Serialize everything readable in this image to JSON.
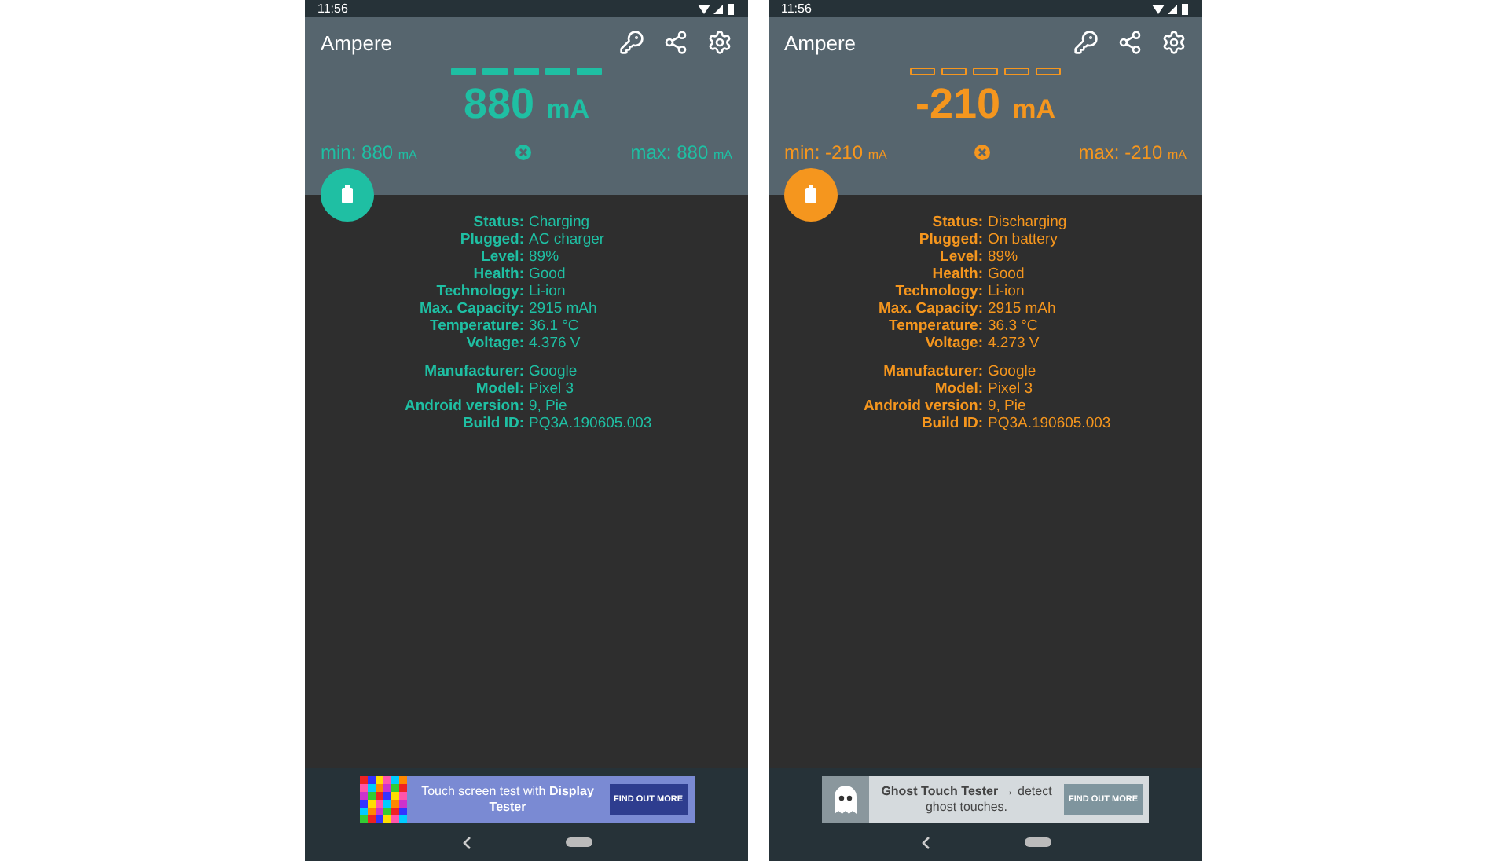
{
  "phones": [
    {
      "status_bar": {
        "time": "11:56"
      },
      "app_bar": {
        "title": "Ampere"
      },
      "color": "#1fbfa3",
      "meter": {
        "filled": true
      },
      "reading": {
        "value": "880",
        "unit": "mA"
      },
      "min": {
        "label": "min:",
        "value": "880",
        "unit": "mA"
      },
      "max": {
        "label": "max:",
        "value": "880",
        "unit": "mA"
      },
      "info_groups": [
        [
          {
            "label": "Status:",
            "value": "Charging"
          },
          {
            "label": "Plugged:",
            "value": "AC charger"
          },
          {
            "label": "Level:",
            "value": "89%"
          },
          {
            "label": "Health:",
            "value": "Good"
          },
          {
            "label": "Technology:",
            "value": "Li-ion"
          },
          {
            "label": "Max. Capacity:",
            "value": "2915 mAh"
          },
          {
            "label": "Temperature:",
            "value": "36.1 °C"
          },
          {
            "label": "Voltage:",
            "value": "4.376 V"
          }
        ],
        [
          {
            "label": "Manufacturer:",
            "value": "Google"
          },
          {
            "label": "Model:",
            "value": "Pixel 3"
          },
          {
            "label": "Android version:",
            "value": "9, Pie"
          },
          {
            "label": "Build ID:",
            "value": "PQ3A.190605.003"
          }
        ]
      ],
      "ad": {
        "kind": "pixels",
        "text": "Touch screen test with **Display Tester**",
        "button": "FIND OUT MORE"
      }
    },
    {
      "status_bar": {
        "time": "11:56"
      },
      "app_bar": {
        "title": "Ampere"
      },
      "color": "#f5961e",
      "meter": {
        "filled": false
      },
      "reading": {
        "value": "-210",
        "unit": "mA"
      },
      "min": {
        "label": "min:",
        "value": "-210",
        "unit": "mA"
      },
      "max": {
        "label": "max:",
        "value": "-210",
        "unit": "mA"
      },
      "info_groups": [
        [
          {
            "label": "Status:",
            "value": "Discharging"
          },
          {
            "label": "Plugged:",
            "value": "On battery"
          },
          {
            "label": "Level:",
            "value": "89%"
          },
          {
            "label": "Health:",
            "value": "Good"
          },
          {
            "label": "Technology:",
            "value": "Li-ion"
          },
          {
            "label": "Max. Capacity:",
            "value": "2915 mAh"
          },
          {
            "label": "Temperature:",
            "value": "36.3 °C"
          },
          {
            "label": "Voltage:",
            "value": "4.273 V"
          }
        ],
        [
          {
            "label": "Manufacturer:",
            "value": "Google"
          },
          {
            "label": "Model:",
            "value": "Pixel 3"
          },
          {
            "label": "Android version:",
            "value": "9, Pie"
          },
          {
            "label": "Build ID:",
            "value": "PQ3A.190605.003"
          }
        ]
      ],
      "ad": {
        "kind": "ghost",
        "text": "**Ghost Touch Tester** → detect ghost touches.",
        "button": "FIND OUT MORE"
      }
    }
  ]
}
